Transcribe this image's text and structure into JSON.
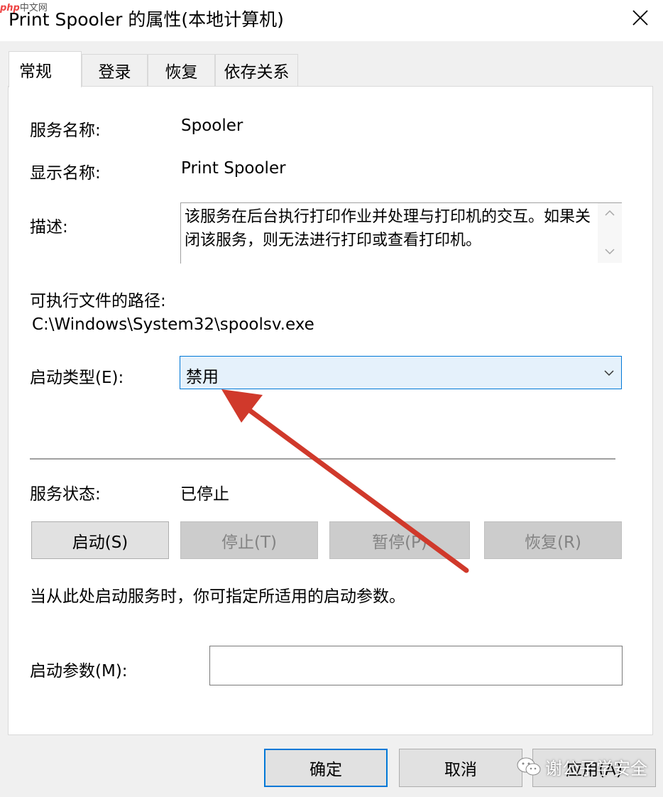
{
  "window": {
    "title": "Print Spooler 的属性(本地计算机)"
  },
  "watermark_top": {
    "brand": "php",
    "site": "中文网"
  },
  "tabs": [
    {
      "label": "常规"
    },
    {
      "label": "登录"
    },
    {
      "label": "恢复"
    },
    {
      "label": "依存关系"
    }
  ],
  "general": {
    "service_name_label": "服务名称:",
    "service_name": "Spooler",
    "display_name_label": "显示名称:",
    "display_name": "Print Spooler",
    "description_label": "描述:",
    "description": "该服务在后台执行打印作业并处理与打印机的交互。如果关闭该服务，则无法进行打印或查看打印机。",
    "path_label": "可执行文件的路径:",
    "path": "C:\\Windows\\System32\\spoolsv.exe",
    "startup_type_label": "启动类型(E):",
    "startup_type": "禁用",
    "status_label": "服务状态:",
    "status": "已停止",
    "buttons": {
      "start": "启动(S)",
      "stop": "停止(T)",
      "pause": "暂停(P)",
      "resume": "恢复(R)"
    },
    "hint": "当从此处启动服务时，你可指定所适用的启动参数。",
    "params_label": "启动参数(M):",
    "params_value": ""
  },
  "footer": {
    "ok": "确定",
    "cancel": "取消",
    "apply": "应用(A)"
  },
  "watermark_bottom": "谢公子学安全",
  "colors": {
    "accent": "#0078d7",
    "annotation_arrow": "#d0392b",
    "select_bg": "#e5f1fb"
  }
}
